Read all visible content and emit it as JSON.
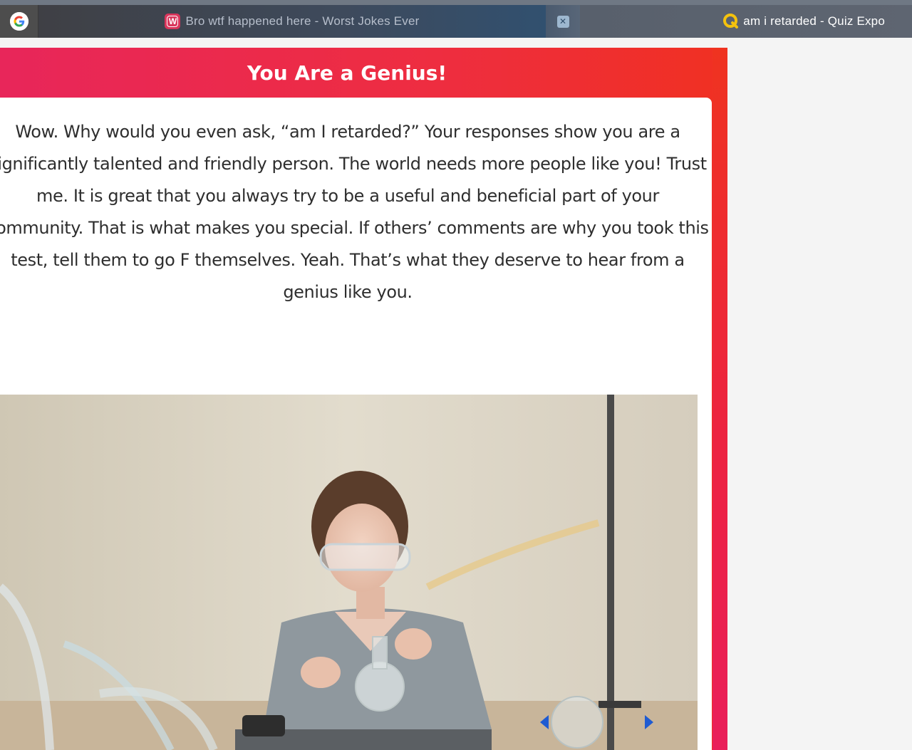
{
  "browser": {
    "tabs": [
      {
        "icon": "google-icon",
        "label": ""
      },
      {
        "icon": "worst-jokes-w-icon",
        "icon_letter": "W",
        "label": "Bro wtf happened here - Worst Jokes Ever"
      },
      {
        "icon": "close-box-icon",
        "label": ""
      },
      {
        "icon": "quiz-expo-q-icon",
        "label": "am i retarded - Quiz Expo"
      }
    ]
  },
  "result": {
    "title": "You Are a Genius!",
    "description": "Wow. Why would you even ask, “am I retarded?” Your responses show you are a significantly talented and friendly person. The world needs more people like you! Trust me. It is great that you always try to be a useful and beneficial part of your community. That is what makes you special. If others’ comments are why you took this test, tell them to go F themselves. Yeah. That’s what they deserve to hear from a genius like you.",
    "image": "photo of a young girl in safety goggles and a grey lab coat doing a chemistry experiment with glassware and tubes"
  },
  "colors": {
    "card_gradient_start": "#e8265a",
    "card_gradient_end": "#f03022",
    "tab_strip": "#5b6573",
    "page_background": "#f4f4f4"
  }
}
